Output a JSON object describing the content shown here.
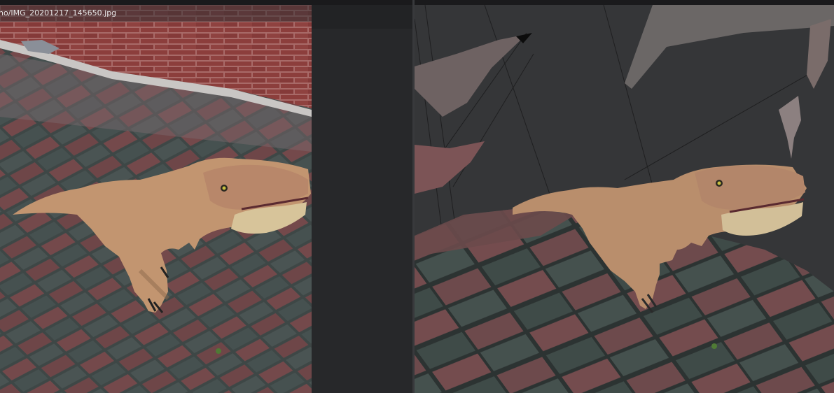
{
  "image_viewer": {
    "filename": "no/IMG_20201217_145650.jpg"
  },
  "viewport": {
    "background_color": "#353638",
    "mesh_subject": "dinosaur-figure"
  },
  "colors": {
    "brick_red": "#7a4a4c",
    "paver_gray": "#3f4a48",
    "wall_red": "#8a3c3a",
    "dino_tan": "#c49a74"
  }
}
